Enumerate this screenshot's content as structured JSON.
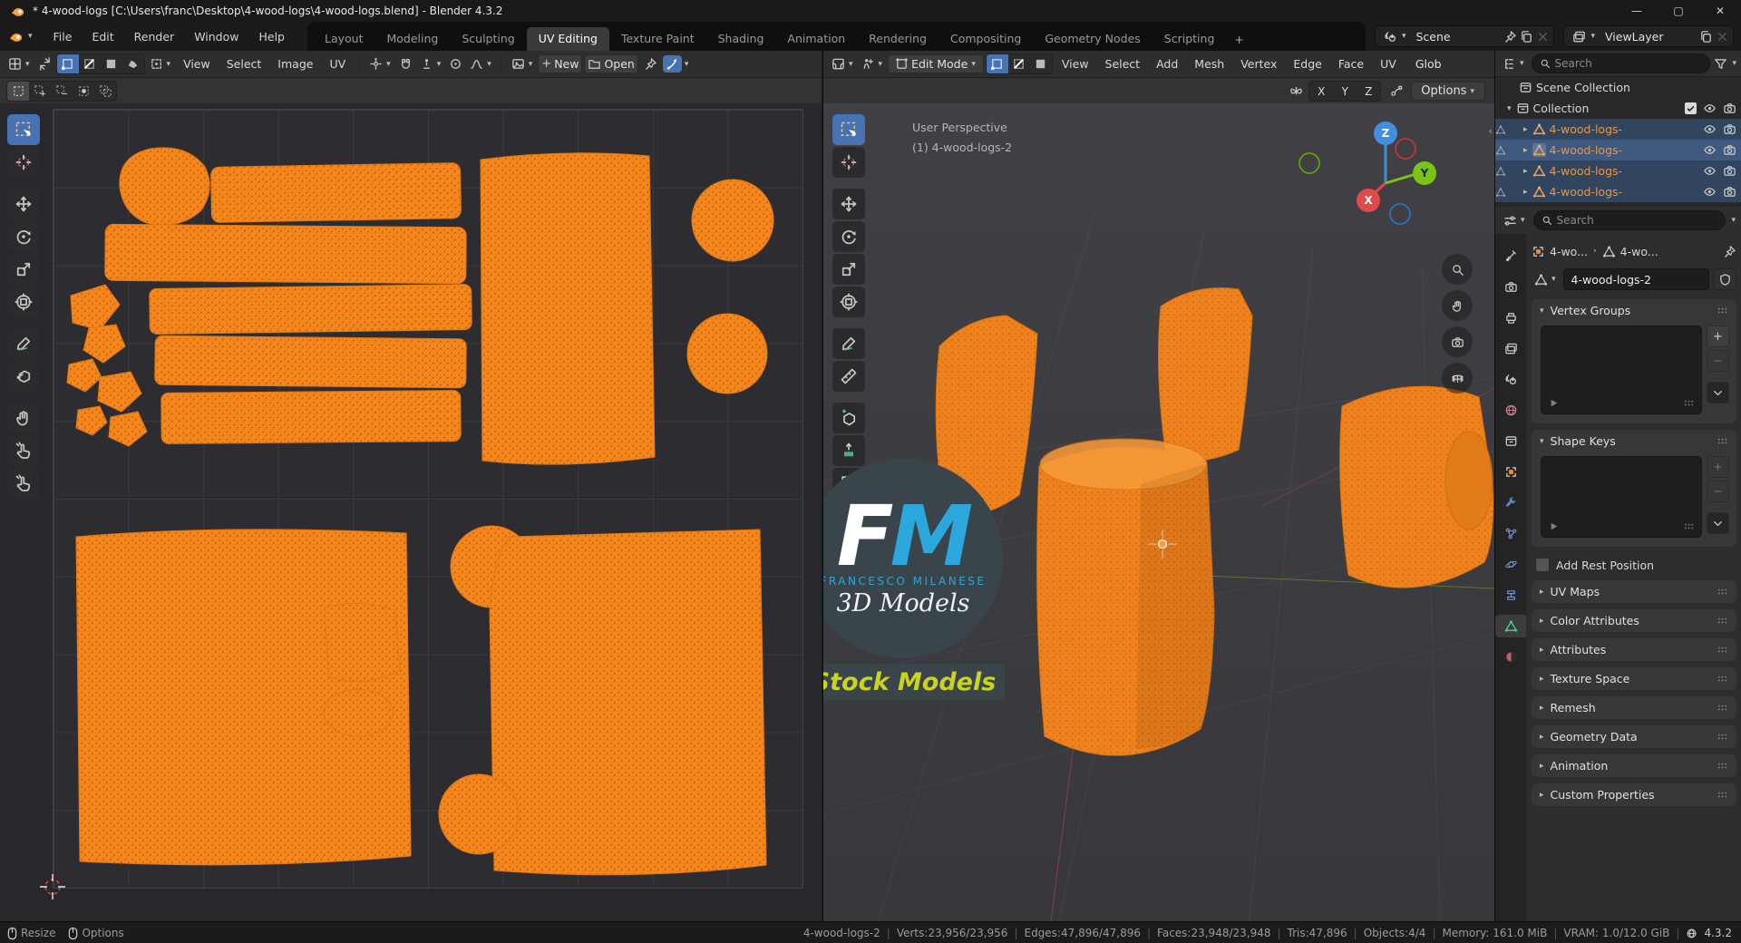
{
  "window": {
    "title": "* 4-wood-logs [C:\\Users\\franc\\Desktop\\4-wood-logs\\4-wood-logs.blend] - Blender 4.3.2",
    "minimize": "—",
    "maximize": "▢",
    "close": "✕"
  },
  "topbar": {
    "menus": [
      "File",
      "Edit",
      "Render",
      "Window",
      "Help"
    ],
    "tabs": [
      "Layout",
      "Modeling",
      "Sculpting",
      "UV Editing",
      "Texture Paint",
      "Shading",
      "Animation",
      "Rendering",
      "Compositing",
      "Geometry Nodes",
      "Scripting"
    ],
    "new_tab": "+",
    "scene_label": "Scene",
    "viewlayer_label": "ViewLayer"
  },
  "uv_editor": {
    "menus": [
      "View",
      "Select",
      "Image",
      "UV"
    ],
    "new_button": "New",
    "open_button": "Open"
  },
  "viewport": {
    "mode": "Edit Mode",
    "menus": [
      "View",
      "Select",
      "Add",
      "Mesh",
      "Vertex",
      "Edge",
      "Face",
      "UV"
    ],
    "orientation": "Glob",
    "options_label": "Options",
    "overlay_line1": "User Perspective",
    "overlay_line2": "(1) 4-wood-logs-2",
    "axis_x": "X",
    "axis_y": "Y",
    "axis_z": "Z",
    "mirror": {
      "x": "X",
      "y": "Y",
      "z": "Z"
    }
  },
  "watermark": {
    "letter_f": "F",
    "letter_m": "M",
    "name": "FRANCESCO MILANESE",
    "line2": "3D Models",
    "badge": "Stock Models"
  },
  "outliner": {
    "search_placeholder": "Search",
    "scene_collection": "Scene Collection",
    "collection": "Collection",
    "items": [
      "4-wood-logs-",
      "4-wood-logs-",
      "4-wood-logs-",
      "4-wood-logs-"
    ]
  },
  "properties": {
    "search_placeholder": "Search",
    "breadcrumb_object": "4-wo...",
    "breadcrumb_data": "4-wo...",
    "name_field": "4-wood-logs-2",
    "panel_vertex_groups": "Vertex Groups",
    "panel_shape_keys": "Shape Keys",
    "add_rest_position": "Add Rest Position",
    "collapsed_panels": [
      "UV Maps",
      "Color Attributes",
      "Attributes",
      "Texture Space",
      "Remesh",
      "Geometry Data",
      "Animation",
      "Custom Properties"
    ]
  },
  "statusbar": {
    "left": [
      "Resize",
      "Options"
    ],
    "segments": [
      "4-wood-logs-2",
      "Verts:23,956/23,956",
      "Edges:47,896/47,896",
      "Faces:23,948/23,948",
      "Tris:47,896",
      "Objects:4/4",
      "Memory: 161.0 MiB",
      "VRAM: 1.0/12.0 GiB"
    ],
    "separator": "|",
    "version": "4.3.2"
  },
  "colors": {
    "selection_orange": "#f6861c",
    "accent_blue": "#4772b3",
    "fm_blue": "#2ba7dc",
    "badge_yellow": "#c9d41b",
    "axis_x_red": "#e24a4a",
    "axis_y_green": "#79c414",
    "axis_z_blue": "#3f8fdd"
  }
}
